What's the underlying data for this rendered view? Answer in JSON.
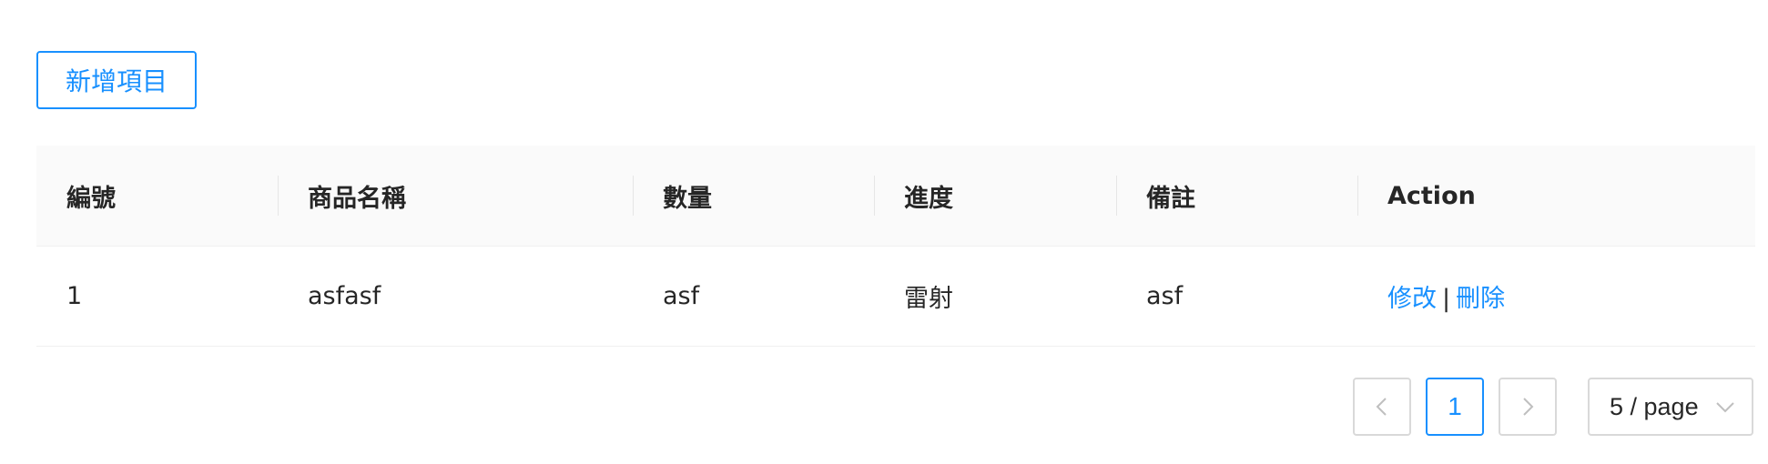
{
  "toolbar": {
    "add_label": "新增項目"
  },
  "table": {
    "columns": [
      "編號",
      "商品名稱",
      "數量",
      "進度",
      "備註",
      "Action"
    ],
    "rows": [
      {
        "id": "1",
        "name": "asfasf",
        "quantity": "asf",
        "progress": "雷射",
        "note": "asf",
        "edit_label": "修改",
        "separator": "|",
        "delete_label": "刪除"
      }
    ]
  },
  "pagination": {
    "current_page": "1",
    "page_size": "5 / page",
    "prev_icon": "chevron-left-icon",
    "next_icon": "chevron-right-icon",
    "dropdown_icon": "chevron-down-icon"
  },
  "colors": {
    "accent": "#1890ff",
    "header_bg": "#fafafa",
    "border": "#d9d9d9"
  }
}
